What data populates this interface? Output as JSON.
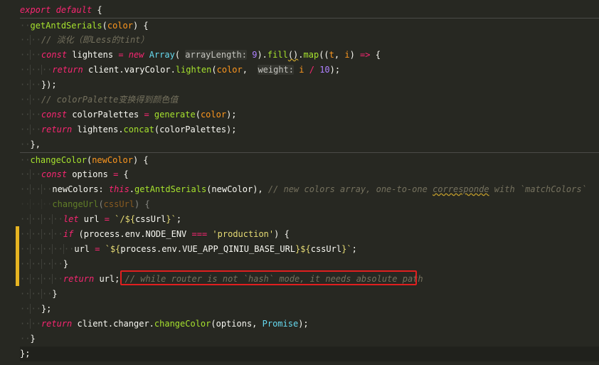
{
  "editor": {
    "theme": "dark",
    "lines": [
      "export default {",
      "  getAntdSerials(color) {",
      "    // 淡化（即Less的tint）",
      "    const lightens = new Array( arrayLength: 9).fill().map((t, i) => {",
      "      return client.varyColor.lighten(color,  weight: i / 10);",
      "    });",
      "    // colorPalette变换得到颜色值",
      "    const colorPalettes = generate(color);",
      "    return lightens.concat(colorPalettes);",
      "  },",
      "  changeColor(newColor) {",
      "    const options = {",
      "      newColors: this.getAntdSerials(newColor), // new colors array, one-to-one corresponde with `matchColors`",
      "      changeUrl(cssUrl) {",
      "        let url = `/${cssUrl}`;",
      "        if (process.env.NODE_ENV === 'production') {",
      "          url = `${process.env.VUE_APP_QINIU_BASE_URL}${cssUrl}`;",
      "        }",
      "        return url; // while router is not `hash` mode, it needs absolute path",
      "      }",
      "    };",
      "    return client.changer.changeColor(options, Promise);",
      "  }",
      "};"
    ],
    "highlighted_comment": "// while router is not `hash` mode, it needs absolute path",
    "colors": {
      "background": "#272822",
      "keyword": "#f92672",
      "function": "#a6e22e",
      "parameter": "#fd971f",
      "number": "#ae81ff",
      "string": "#e6db74",
      "comment": "#75715e",
      "highlight_box": "#e01f1f",
      "gutter_change_marker": "#e6b422"
    }
  }
}
